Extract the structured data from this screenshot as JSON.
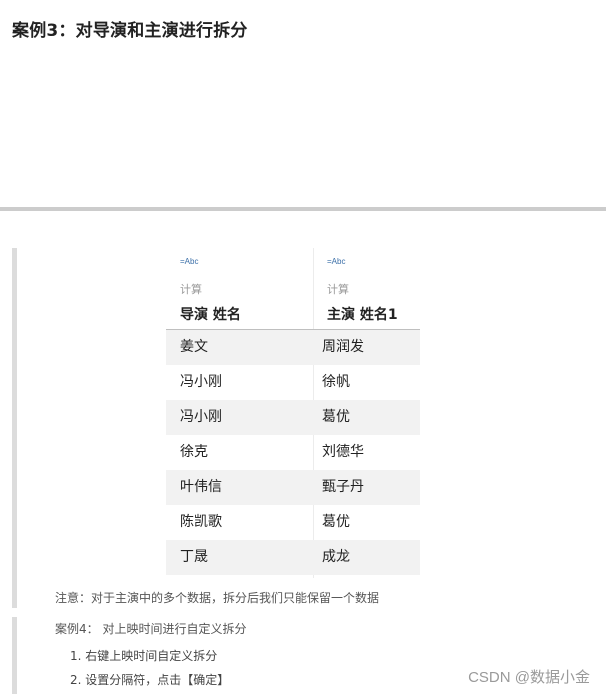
{
  "heading": "案例3：对导演和主演进行拆分",
  "table": {
    "columns": [
      {
        "type_badge": "=Abc",
        "calc_label": "计算",
        "name": "导演 姓名"
      },
      {
        "type_badge": "=Abc",
        "calc_label": "计算",
        "name": "主演 姓名1"
      }
    ],
    "rows": [
      [
        "姜文",
        "周润发"
      ],
      [
        "冯小刚",
        "徐帆"
      ],
      [
        "冯小刚",
        "葛优"
      ],
      [
        "徐克",
        "刘德华"
      ],
      [
        "叶伟信",
        "甄子丹"
      ],
      [
        "陈凯歌",
        "葛优"
      ],
      [
        "丁晟",
        "成龙"
      ]
    ]
  },
  "note": "注意：对于主演中的多个数据，拆分后我们只能保留一个数据",
  "case4": "案例4： 对上映时间进行自定义拆分",
  "steps": [
    "1. 右键上映时间自定义拆分",
    "2. 设置分隔符，点击【确定】"
  ],
  "watermark": "CSDN @数据小金"
}
